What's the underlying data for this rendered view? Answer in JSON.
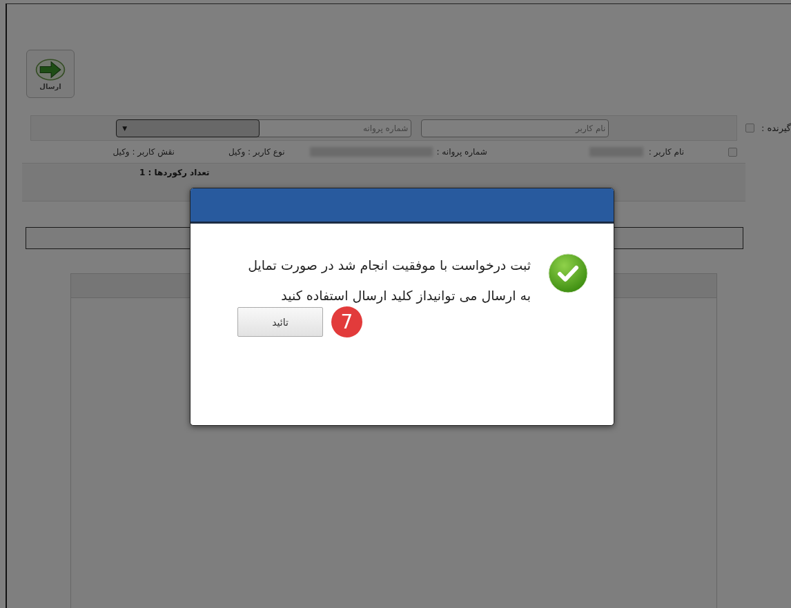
{
  "toolbar": {
    "send_button": {
      "label": "ارسال"
    }
  },
  "receiver": {
    "label": "گیرنده :",
    "checked": false,
    "username_field": {
      "placeholder": "نام کاربر"
    },
    "license_field": {
      "placeholder": "شماره پروانه"
    },
    "select_arrow": "▼"
  },
  "results": {
    "rows": [
      {
        "checked": false,
        "username_label": "نام کاربر :",
        "license_label": "شماره پروانه :",
        "user_type": "نوع کاربر : وکیل",
        "user_role": "نقش کاربر : وکیل"
      }
    ],
    "record_count": "تعداد رکوردها : 1"
  },
  "dialog": {
    "message": "ثبت درخواست با موفقیت انجام شد در صورت تمایل به ارسال می توانیداز کلید ارسال استفاده کنید",
    "confirm_button": "تائید",
    "badge": "7"
  }
}
